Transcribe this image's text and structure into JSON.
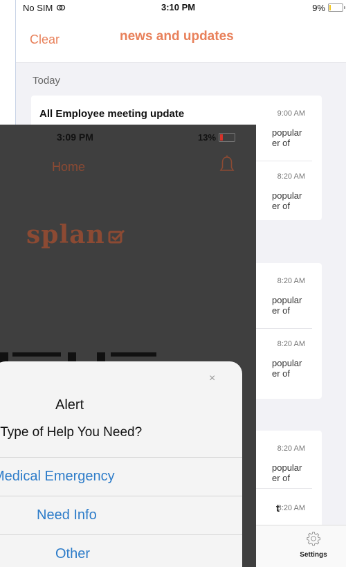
{
  "news_screen": {
    "status_bar": {
      "carrier": "No SIM",
      "time": "3:10 PM",
      "battery": "9%"
    },
    "header": {
      "clear_label": "Clear",
      "title": "news and updates"
    },
    "section_label": "Today",
    "items": [
      {
        "title": "All Employee meeting update",
        "time": "9:00 AM",
        "body_line1": "popular",
        "body_line2": "er of"
      },
      {
        "title": "",
        "time": "8:20 AM",
        "body_line1": "popular",
        "body_line2": "er of"
      },
      {
        "title": "",
        "time": "8:20 AM",
        "body_line1": "popular",
        "body_line2": "er of"
      },
      {
        "title": "",
        "time": "8:20 AM",
        "body_line1": "popular",
        "body_line2": "er of"
      },
      {
        "title": "",
        "time": "8:20 AM",
        "body_line1": "popular",
        "body_line2": "er of"
      },
      {
        "title": "t",
        "time": "8:20 AM",
        "body_line1": "",
        "body_line2": ""
      }
    ],
    "tab_bar": {
      "settings_label": "Settings"
    }
  },
  "home_screen": {
    "status_bar": {
      "time": "3:09 PM",
      "battery": "13%"
    },
    "title": "Home",
    "logo_text": "splan"
  },
  "alert": {
    "close_symbol": "×",
    "title": "Alert",
    "message": "t Type of Help You Need?",
    "options": [
      "Medical Emergency",
      "Need Info",
      "Other"
    ]
  },
  "colors": {
    "accent": "#e8805a",
    "brand": "#8c4a33",
    "alert_button": "#2d7cc9",
    "battery_low": "#d6332a"
  }
}
